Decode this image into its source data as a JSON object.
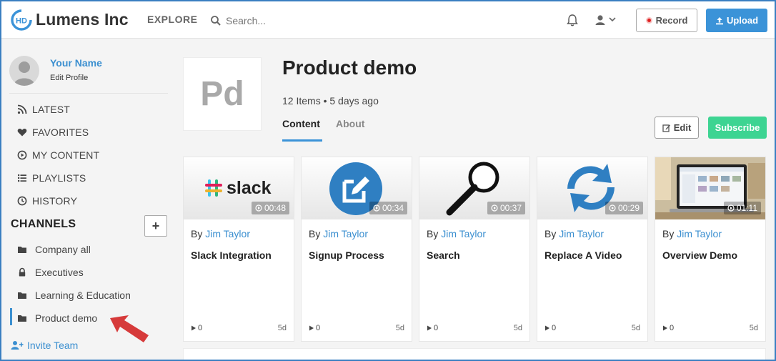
{
  "header": {
    "logo_mark": "HD",
    "logo_text": "Lumens Inc",
    "explore_label": "EXPLORE",
    "search_placeholder": "Search...",
    "record_label": "Record",
    "upload_label": "Upload",
    "colors": {
      "accent": "#3b93d8",
      "record_dot": "#e02020"
    }
  },
  "profile": {
    "name": "Your Name",
    "edit_label": "Edit Profile"
  },
  "nav": [
    {
      "label": "LATEST",
      "icon": "rss-icon"
    },
    {
      "label": "FAVORITES",
      "icon": "heart-icon"
    },
    {
      "label": "MY CONTENT",
      "icon": "play-circle-icon"
    },
    {
      "label": "PLAYLISTS",
      "icon": "list-icon"
    },
    {
      "label": "HISTORY",
      "icon": "clock-icon"
    }
  ],
  "channels": {
    "title": "CHANNELS",
    "add_label": "+",
    "items": [
      {
        "label": "Company all",
        "icon": "folder-icon"
      },
      {
        "label": "Executives",
        "icon": "lock-icon"
      },
      {
        "label": "Learning & Education",
        "icon": "folder-icon"
      },
      {
        "label": "Product demo",
        "icon": "folder-icon",
        "active": true
      }
    ],
    "invite_label": "Invite Team"
  },
  "channel": {
    "initials": "Pd",
    "title": "Product demo",
    "meta": "12 Items • 5 days ago",
    "tabs": [
      {
        "label": "Content",
        "active": true
      },
      {
        "label": "About",
        "active": false
      }
    ],
    "edit_label": "Edit",
    "subscribe_label": "Subscribe",
    "colors": {
      "subscribe": "#3dd492"
    }
  },
  "videos": [
    {
      "by": "By",
      "author": "Jim Taylor",
      "title": "Slack Integration",
      "duration": "00:48",
      "views": "0",
      "age": "5d",
      "thumb": "slack-logo"
    },
    {
      "by": "By",
      "author": "Jim Taylor",
      "title": "Signup Process",
      "duration": "00:34",
      "views": "0",
      "age": "5d",
      "thumb": "edit-circle-icon"
    },
    {
      "by": "By",
      "author": "Jim Taylor",
      "title": "Search",
      "duration": "00:37",
      "views": "0",
      "age": "5d",
      "thumb": "magnifier-icon"
    },
    {
      "by": "By",
      "author": "Jim Taylor",
      "title": "Replace A Video",
      "duration": "00:29",
      "views": "0",
      "age": "5d",
      "thumb": "refresh-arrows-icon"
    },
    {
      "by": "By",
      "author": "Jim Taylor",
      "title": "Overview Demo",
      "duration": "01:11",
      "views": "0",
      "age": "5d",
      "thumb": "laptop-photo"
    }
  ],
  "slack_wordmark": "slack"
}
